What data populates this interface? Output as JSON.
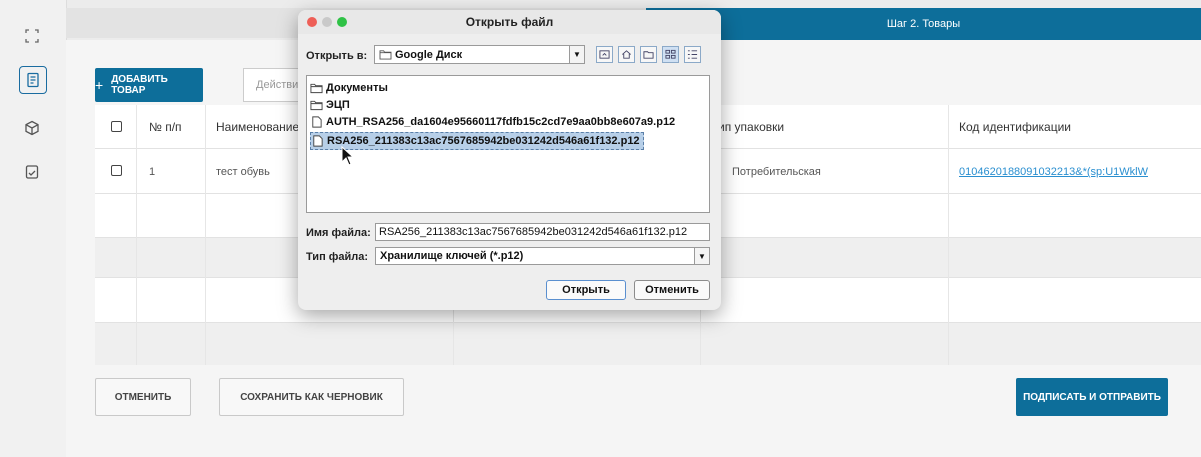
{
  "sidebar": {
    "icons": [
      "expand-icon",
      "document-icon",
      "cube-icon",
      "checklist-icon"
    ]
  },
  "stepper": {
    "step2_label": "Шаг 2. Товары"
  },
  "toolbar": {
    "add_label": "ДОБАВИТЬ ТОВАР",
    "actions_placeholder": "Действие"
  },
  "table": {
    "headers": [
      "№ п/п",
      "Наименование",
      "ип упаковки",
      "Код идентификации"
    ],
    "rows": [
      {
        "num": "1",
        "name": "тест обувь",
        "package": "Потребительская",
        "code": "0104620188091032213&*(sp:U1WklW"
      }
    ]
  },
  "footer": {
    "cancel_label": "ОТМЕНИТЬ",
    "draft_label": "СОХРАНИТЬ КАК ЧЕРНОВИК",
    "submit_label": "ПОДПИСАТЬ И ОТПРАВИТЬ"
  },
  "dialog": {
    "title": "Открыть файл",
    "open_in_label": "Открыть в:",
    "location": "Google Диск",
    "files": [
      {
        "name": "Документы",
        "type": "folder"
      },
      {
        "name": "ЭЦП",
        "type": "folder"
      },
      {
        "name": "AUTH_RSA256_da1604e95660117fdfb15c2cd7e9aa0bb8e607a9.p12",
        "type": "file"
      },
      {
        "name": "RSA256_211383c13ac7567685942be031242d546a61f132.p12",
        "type": "file"
      }
    ],
    "filename_label": "Имя файла:",
    "filename_value": "RSA256_211383c13ac7567685942be031242d546a61f132.p12",
    "filetype_label": "Тип файла:",
    "filetype_value": "Хранилище ключей (*.p12)",
    "open_button": "Открыть",
    "cancel_button": "Отменить"
  },
  "colors": {
    "accent": "#0d6e9a",
    "link": "#2a8fd0",
    "selection": "#b7cfe8"
  }
}
